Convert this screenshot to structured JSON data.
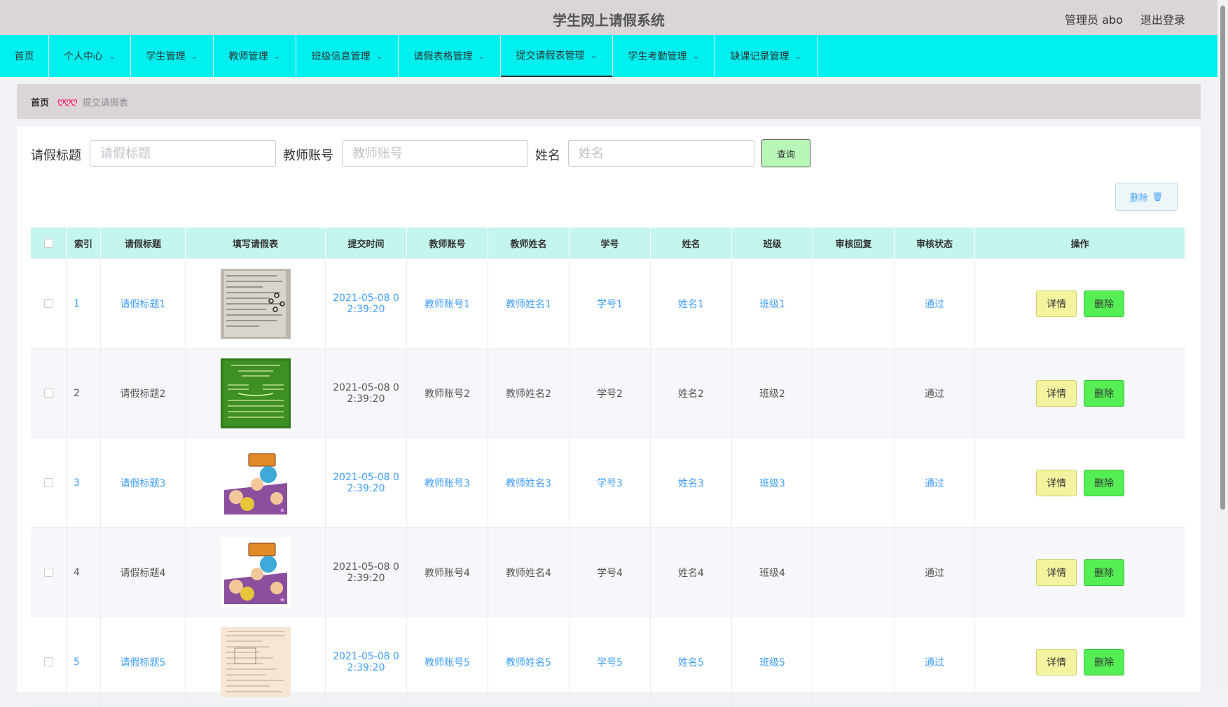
{
  "header": {
    "title": "学生网上请假系统",
    "user_info": "管理员 abo",
    "logout_label": "退出登录"
  },
  "nav": {
    "items": [
      {
        "label": "首页",
        "dropdown": false
      },
      {
        "label": "个人中心",
        "dropdown": true
      },
      {
        "label": "学生管理",
        "dropdown": true
      },
      {
        "label": "教师管理",
        "dropdown": true
      },
      {
        "label": "班级信息管理",
        "dropdown": true
      },
      {
        "label": "请假表格管理",
        "dropdown": true
      },
      {
        "label": "提交请假表管理",
        "dropdown": true,
        "active": true
      },
      {
        "label": "学生考勤管理",
        "dropdown": true
      },
      {
        "label": "缺课记录管理",
        "dropdown": true
      }
    ]
  },
  "breadcrumb": {
    "home": "首页",
    "separator": "ღღღ",
    "current": "提交请假表"
  },
  "search": {
    "title_label": "请假标题",
    "title_placeholder": "请假标题",
    "account_label": "教师账号",
    "account_placeholder": "教师账号",
    "name_label": "姓名",
    "name_placeholder": "姓名",
    "query_button": "查询"
  },
  "toolbar": {
    "delete_label": "删除"
  },
  "table": {
    "headers": [
      "索引",
      "请假标题",
      "填写请假表",
      "提交时间",
      "教师账号",
      "教师姓名",
      "学号",
      "姓名",
      "班级",
      "审核回复",
      "审核状态",
      "操作"
    ],
    "rows": [
      {
        "index": "1",
        "title": "请假标题1",
        "image": "handwritten-notes",
        "time_line1": "2021-05-08 0",
        "time_line2": "2:39:20",
        "teacher_account": "教师账号1",
        "teacher_name": "教师姓名1",
        "student_no": "学号1",
        "name": "姓名1",
        "class": "班级1",
        "reply": "",
        "status": "通过",
        "highlight": true
      },
      {
        "index": "2",
        "title": "请假标题2",
        "image": "green-chalkboard",
        "time_line1": "2021-05-08 0",
        "time_line2": "2:39:20",
        "teacher_account": "教师账号2",
        "teacher_name": "教师姓名2",
        "student_no": "学号2",
        "name": "姓名2",
        "class": "班级2",
        "reply": "",
        "status": "通过",
        "highlight": false
      },
      {
        "index": "3",
        "title": "请假标题3",
        "image": "english-cartoon",
        "time_line1": "2021-05-08 0",
        "time_line2": "2:39:20",
        "teacher_account": "教师账号3",
        "teacher_name": "教师姓名3",
        "student_no": "学号3",
        "name": "姓名3",
        "class": "班级3",
        "reply": "",
        "status": "通过",
        "highlight": true
      },
      {
        "index": "4",
        "title": "请假标题4",
        "image": "english-cartoon",
        "time_line1": "2021-05-08 0",
        "time_line2": "2:39:20",
        "teacher_account": "教师账号4",
        "teacher_name": "教师姓名4",
        "student_no": "学号4",
        "name": "姓名4",
        "class": "班级4",
        "reply": "",
        "status": "通过",
        "highlight": false
      },
      {
        "index": "5",
        "title": "请假标题5",
        "image": "paper-form",
        "time_line1": "2021-05-08 0",
        "time_line2": "2:39:20",
        "teacher_account": "教师账号5",
        "teacher_name": "教师姓名5",
        "student_no": "学号5",
        "name": "姓名5",
        "class": "班级5",
        "reply": "",
        "status": "通过",
        "highlight": true
      }
    ],
    "detail_label": "详情",
    "delete_label": "删除"
  },
  "colors": {
    "nav_bg": "#00f0f0",
    "header_bg": "#dcd5d6",
    "link_blue": "#409eff",
    "table_head_bg": "#c4f6ee"
  }
}
